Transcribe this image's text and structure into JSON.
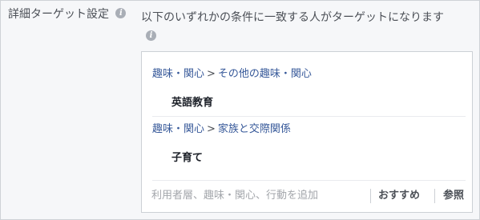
{
  "section": {
    "label": "詳細ターゲット設定",
    "description": "以下のいずれかの条件に一致する人がターゲットになります",
    "info_icon": "info-icon"
  },
  "targeting": {
    "items": [
      {
        "category": "趣味・関心",
        "separator": ">",
        "subcategory": "その他の趣味・関心",
        "name": "英語教育"
      },
      {
        "category": "趣味・関心",
        "separator": ">",
        "subcategory": "家族と交際関係",
        "name": "子育て"
      }
    ]
  },
  "search": {
    "placeholder": "利用者層、趣味・関心、行動を追加",
    "value": ""
  },
  "actions": {
    "suggestions_label": "おすすめ",
    "browse_label": "参照"
  },
  "colors": {
    "link": "#365899",
    "text": "#4b4f56",
    "bold_text": "#1d2129",
    "panel_bg": "#f6f7f9",
    "border": "#ccd0d5",
    "icon_grey": "#a9aeb6"
  }
}
